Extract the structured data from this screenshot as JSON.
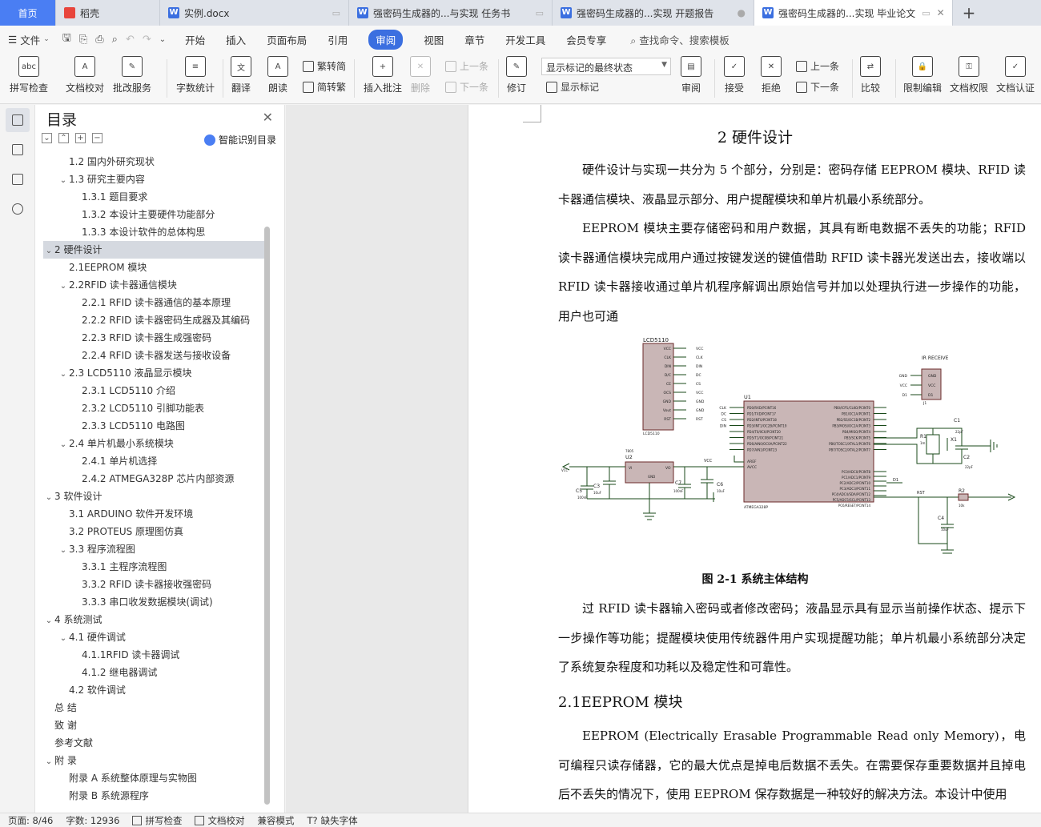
{
  "tabs": [
    {
      "label": "首页",
      "type": "home"
    },
    {
      "label": "稻壳",
      "type": "docer"
    },
    {
      "label": "实例.docx",
      "type": "doc"
    },
    {
      "label": "强密码生成器的...与实现 任务书",
      "type": "doc"
    },
    {
      "label": "强密码生成器的...实现 开题报告",
      "type": "doc"
    },
    {
      "label": "强密码生成器的...实现 毕业论文",
      "type": "doc",
      "active": true
    }
  ],
  "menu": {
    "file": "文件",
    "items": [
      "开始",
      "插入",
      "页面布局",
      "引用",
      "审阅",
      "视图",
      "章节",
      "开发工具",
      "会员专享"
    ],
    "active": "审阅",
    "search": "查找命令、搜索模板"
  },
  "ribbon": {
    "spellcheck": "拼写检查",
    "doc_check": "文档校对",
    "batch": "批改服务",
    "wordcount": "字数统计",
    "translate": "翻译",
    "read": "朗读",
    "to_trad": "繁转简",
    "to_simp": "简转繁",
    "insert_comment": "插入批注",
    "delete": "删除",
    "prev": "上一条",
    "next": "下一条",
    "revise": "修订",
    "markup_select": "显示标记的最终状态",
    "show_markup": "显示标记",
    "review": "审阅",
    "accept": "接受",
    "reject": "拒绝",
    "prev2": "上一条",
    "next2": "下一条",
    "compare": "比较",
    "restrict": "限制编辑",
    "doc_perm": "文档权限",
    "doc_cert": "文档认证"
  },
  "toc": {
    "title": "目录",
    "smart": "智能识别目录",
    "items": [
      {
        "text": "1.2 国内外研究现状",
        "level": 2
      },
      {
        "text": "1.3 研究主要内容",
        "level": 2,
        "caret": true
      },
      {
        "text": "1.3.1 题目要求",
        "level": 3
      },
      {
        "text": "1.3.2 本设计主要硬件功能部分",
        "level": 3
      },
      {
        "text": "1.3.3 本设计软件的总体构思",
        "level": 3
      },
      {
        "text": "2 硬件设计",
        "level": 1,
        "caret": true,
        "selected": true
      },
      {
        "text": "2.1EEPROM 模块",
        "level": 2
      },
      {
        "text": "2.2RFID 读卡器通信模块",
        "level": 2,
        "caret": true
      },
      {
        "text": "2.2.1 RFID 读卡器通信的基本原理",
        "level": 3
      },
      {
        "text": "2.2.2 RFID 读卡器密码生成器及其编码",
        "level": 3
      },
      {
        "text": "2.2.3 RFID 读卡器生成强密码",
        "level": 3
      },
      {
        "text": "2.2.4 RFID 读卡器发送与接收设备",
        "level": 3
      },
      {
        "text": "2.3 LCD5110 液晶显示模块",
        "level": 2,
        "caret": true
      },
      {
        "text": "2.3.1 LCD5110 介绍",
        "level": 3
      },
      {
        "text": "2.3.2 LCD5110 引脚功能表",
        "level": 3
      },
      {
        "text": "2.3.3 LCD5110 电路图",
        "level": 3
      },
      {
        "text": "2.4  单片机最小系统模块",
        "level": 2,
        "caret": true
      },
      {
        "text": "2.4.1 单片机选择",
        "level": 3
      },
      {
        "text": "2.4.2 ATMEGA328P 芯片内部资源",
        "level": 3
      },
      {
        "text": "3 软件设计",
        "level": 1,
        "caret": true
      },
      {
        "text": "3.1 ARDUINO 软件开发环境",
        "level": 2
      },
      {
        "text": "3.2 PROTEUS 原理图仿真",
        "level": 2
      },
      {
        "text": "3.3  程序流程图",
        "level": 2,
        "caret": true
      },
      {
        "text": "3.3.1  主程序流程图",
        "level": 3
      },
      {
        "text": "3.3.2 RFID 读卡器接收强密码",
        "level": 3
      },
      {
        "text": "3.3.3  串口收发数据模块(调试)",
        "level": 3
      },
      {
        "text": "4 系统测试",
        "level": 1,
        "caret": true
      },
      {
        "text": "4.1  硬件调试",
        "level": 2,
        "caret": true
      },
      {
        "text": "4.1.1RFID 读卡器调试",
        "level": 3
      },
      {
        "text": "4.1.2 继电器调试",
        "level": 3
      },
      {
        "text": "4.2 软件调试",
        "level": 2
      },
      {
        "text": "总   结",
        "level": 1
      },
      {
        "text": "致   谢",
        "level": 1
      },
      {
        "text": "参考文献",
        "level": 1
      },
      {
        "text": "附   录",
        "level": 1,
        "caret": true
      },
      {
        "text": "附录 A    系统整体原理与实物图",
        "level": 2
      },
      {
        "text": "附录 B    系统源程序",
        "level": 2
      }
    ]
  },
  "doc": {
    "heading": "2 硬件设计",
    "p1": "硬件设计与实现一共分为 5 个部分，分别是：密码存储 EEPROM 模块、RFID 读卡器通信模块、液晶显示部分、用户提醒模块和单片机最小系统部分。",
    "p2": "EEPROM 模块主要存储密码和用户数据，其具有断电数据不丢失的功能；RFID 读卡器通信模块完成用户通过按键发送的键值借助 RFID 读卡器光发送出去，接收端以 RFID 读卡器接收通过单片机程序解调出原始信号并加以处理执行进一步操作的功能，用户也可通",
    "caption": "图 2-1  系统主体结构",
    "p3": "过 RFID 读卡器输入密码或者修改密码；液晶显示具有显示当前操作状态、提示下一步操作等功能；提醒模块使用传统器件用户实现提醒功能；单片机最小系统部分决定了系统复杂程度和功耗以及稳定性和可靠性。",
    "h2": "2.1EEPROM 模块",
    "p4": "EEPROM (Electrically Erasable Programmable Read only Memory)，电可编程只读存储器，它的最大优点是掉电后数据不丢失。在需要保存重要数据并且掉电后不丢失的情况下，使用 EEPROM 保存数据是一种较好的解决方法。本设计中使用"
  },
  "schematic": {
    "lcd": "LCD5110",
    "lcd_pins": [
      "VCC",
      "CLK",
      "DIN",
      "D/C",
      "CE",
      "OCS",
      "GND",
      "Vout",
      "RST"
    ],
    "lcd_nets": [
      "VCC",
      "CLK",
      "DIN",
      "DC",
      "CS",
      "VCC",
      "GND",
      "GND",
      "RST"
    ],
    "lcd_sub": "LCD5110",
    "ir": "IR RECEIVE",
    "ir_pins": [
      "GND",
      "VCC",
      "D1"
    ],
    "ir_nets": [
      "GND",
      "VCC",
      "D1"
    ],
    "ir_ref": "J1",
    "u1": "U1",
    "u1_part": "ATMEGA328P",
    "u1_left": [
      "PD0/RXD/PCINT16",
      "PD1/TXD/PCINT17",
      "PD2/INT0/PCINT18",
      "PD3/INT1/OC2B/PCINT19",
      "PD4/T0/XCK/PCINT20",
      "PD5/T1/OC0B/PCINT21",
      "PD6/AIN0/OC0A/PCINT22",
      "PD7/AIN1/PCINT23"
    ],
    "u1_left_nets": [
      "CLK",
      "DC",
      "CS",
      "DIN"
    ],
    "u1_right": [
      "PB0/ICP1/CLKO/PCINT0",
      "PB1/OC1A/PCINT1",
      "PB2/SS/OC1B/PCINT2",
      "PB3/MOSI/OC2A/PCINT3",
      "PB4/MISO/PCINT4",
      "PB5/SCK/PCINT5",
      "PB6/TOSC1/XTAL1/PCINT6",
      "PB7/TOSC2/XTAL2/PCINT7"
    ],
    "u1_right2": [
      "PC0/ADC0/PCINT8",
      "PC1/ADC1/PCINT9",
      "PC2/ADC2/PCINT10",
      "PC3/ADC3/PCINT11",
      "PC4/ADC4/SDA/PCINT12",
      "PC5/ADC5/SCL/PCINT13",
      "PC6/RESET/PCINT14"
    ],
    "aref": "AREF",
    "avcc": "AVCC",
    "u2": "U2",
    "u2_part": "7805",
    "vi": "VI",
    "vo": "VO",
    "gnd": "GND",
    "vcc": "VCC",
    "c1": "C1",
    "c2": "C2",
    "c3": "C3",
    "c4": "C4",
    "c5": "C5",
    "c6": "C6",
    "c7": "C7",
    "r1": "R1",
    "r2": "R2",
    "x1": "X1",
    "v22p": "22pF",
    "v100n": "100nF",
    "v10u": "10uF",
    "v10k": "10k",
    "v1m": "1m",
    "rst": "RST",
    "d1": "D1"
  },
  "status": {
    "page": "页面: 8/46",
    "words": "字数: 12936",
    "spell": "拼写检查",
    "check": "文档校对",
    "compat": "兼容模式",
    "font": "缺失字体"
  },
  "colors": {
    "accent": "#3b6fe0",
    "home_tab": "#4a7ef3",
    "chip_fill": "#c9b6b6",
    "wire": "#1a4a1a",
    "pin_red": "#b40000"
  }
}
